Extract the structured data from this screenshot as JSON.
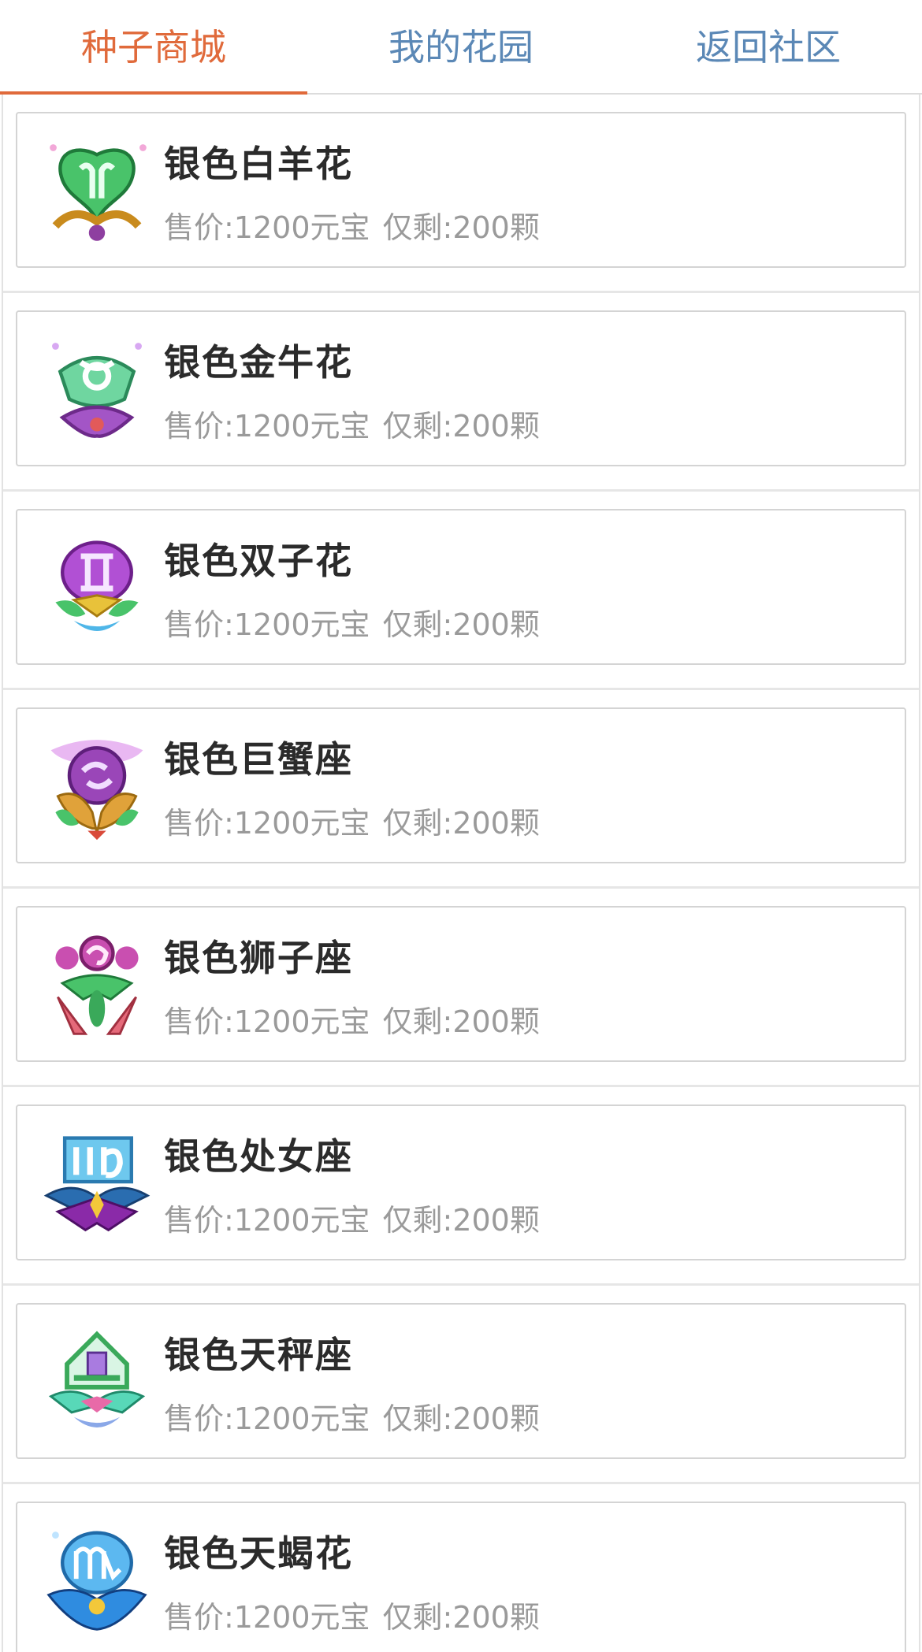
{
  "tabs": [
    {
      "label": "种子商城",
      "active": true
    },
    {
      "label": "我的花园",
      "active": false
    },
    {
      "label": "返回社区",
      "active": false
    }
  ],
  "colors": {
    "active_tab": "#e06a3b",
    "inactive_tab": "#5b88b6"
  },
  "seeds": [
    {
      "name": "银色白羊花",
      "price": "售价:1200元宝",
      "remaining": "仅剩:200颗",
      "icon": "aries-flower-icon"
    },
    {
      "name": "银色金牛花",
      "price": "售价:1200元宝",
      "remaining": "仅剩:200颗",
      "icon": "taurus-flower-icon"
    },
    {
      "name": "银色双子花",
      "price": "售价:1200元宝",
      "remaining": "仅剩:200颗",
      "icon": "gemini-flower-icon"
    },
    {
      "name": "银色巨蟹座",
      "price": "售价:1200元宝",
      "remaining": "仅剩:200颗",
      "icon": "cancer-flower-icon"
    },
    {
      "name": "银色狮子座",
      "price": "售价:1200元宝",
      "remaining": "仅剩:200颗",
      "icon": "leo-flower-icon"
    },
    {
      "name": "银色处女座",
      "price": "售价:1200元宝",
      "remaining": "仅剩:200颗",
      "icon": "virgo-flower-icon"
    },
    {
      "name": "银色天秤座",
      "price": "售价:1200元宝",
      "remaining": "仅剩:200颗",
      "icon": "libra-flower-icon"
    },
    {
      "name": "银色天蝎花",
      "price": "售价:1200元宝",
      "remaining": "仅剩:200颗",
      "icon": "scorpio-flower-icon"
    }
  ]
}
